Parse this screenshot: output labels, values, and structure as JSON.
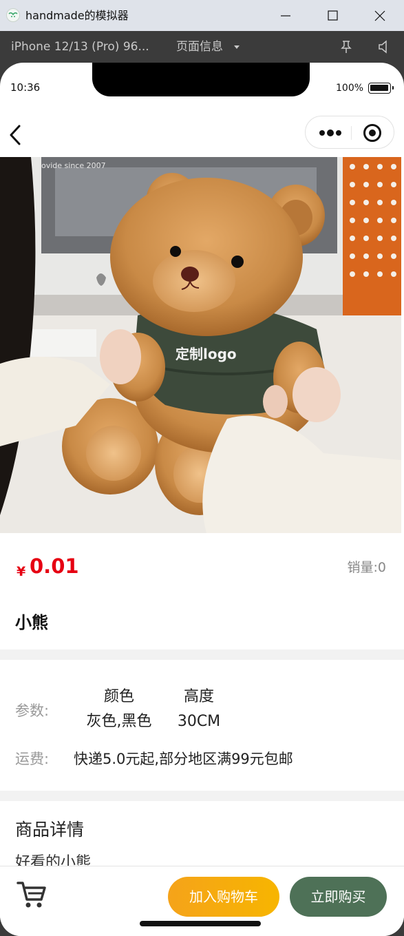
{
  "window": {
    "title": "handmade的模拟器"
  },
  "simulator": {
    "device": "iPhone 12/13 (Pro) 96...",
    "page_info": "页面信息"
  },
  "status_bar": {
    "time": "10:36",
    "battery": "100%"
  },
  "product": {
    "image_alt": "bear-product-image",
    "image_text": "定制logo",
    "image_bg_text": "ovide since 2007",
    "currency": "¥",
    "price": "0.01",
    "sales_label": "销量:",
    "sales_value": "0",
    "title": "小熊"
  },
  "params": {
    "label": "参数:",
    "columns": [
      {
        "name": "颜色",
        "value": "灰色,黑色"
      },
      {
        "name": "高度",
        "value": "30CM"
      }
    ],
    "shipping_label": "运费:",
    "shipping_value": "快递5.0元起,部分地区满99元包邮"
  },
  "details": {
    "title": "商品详情",
    "text": "好看的小熊"
  },
  "actions": {
    "add_to_cart": "加入购物车",
    "buy_now": "立即购买"
  },
  "colors": {
    "price": "#e60012",
    "cart_button": "#f5a31a",
    "buy_button": "#4e7157"
  }
}
